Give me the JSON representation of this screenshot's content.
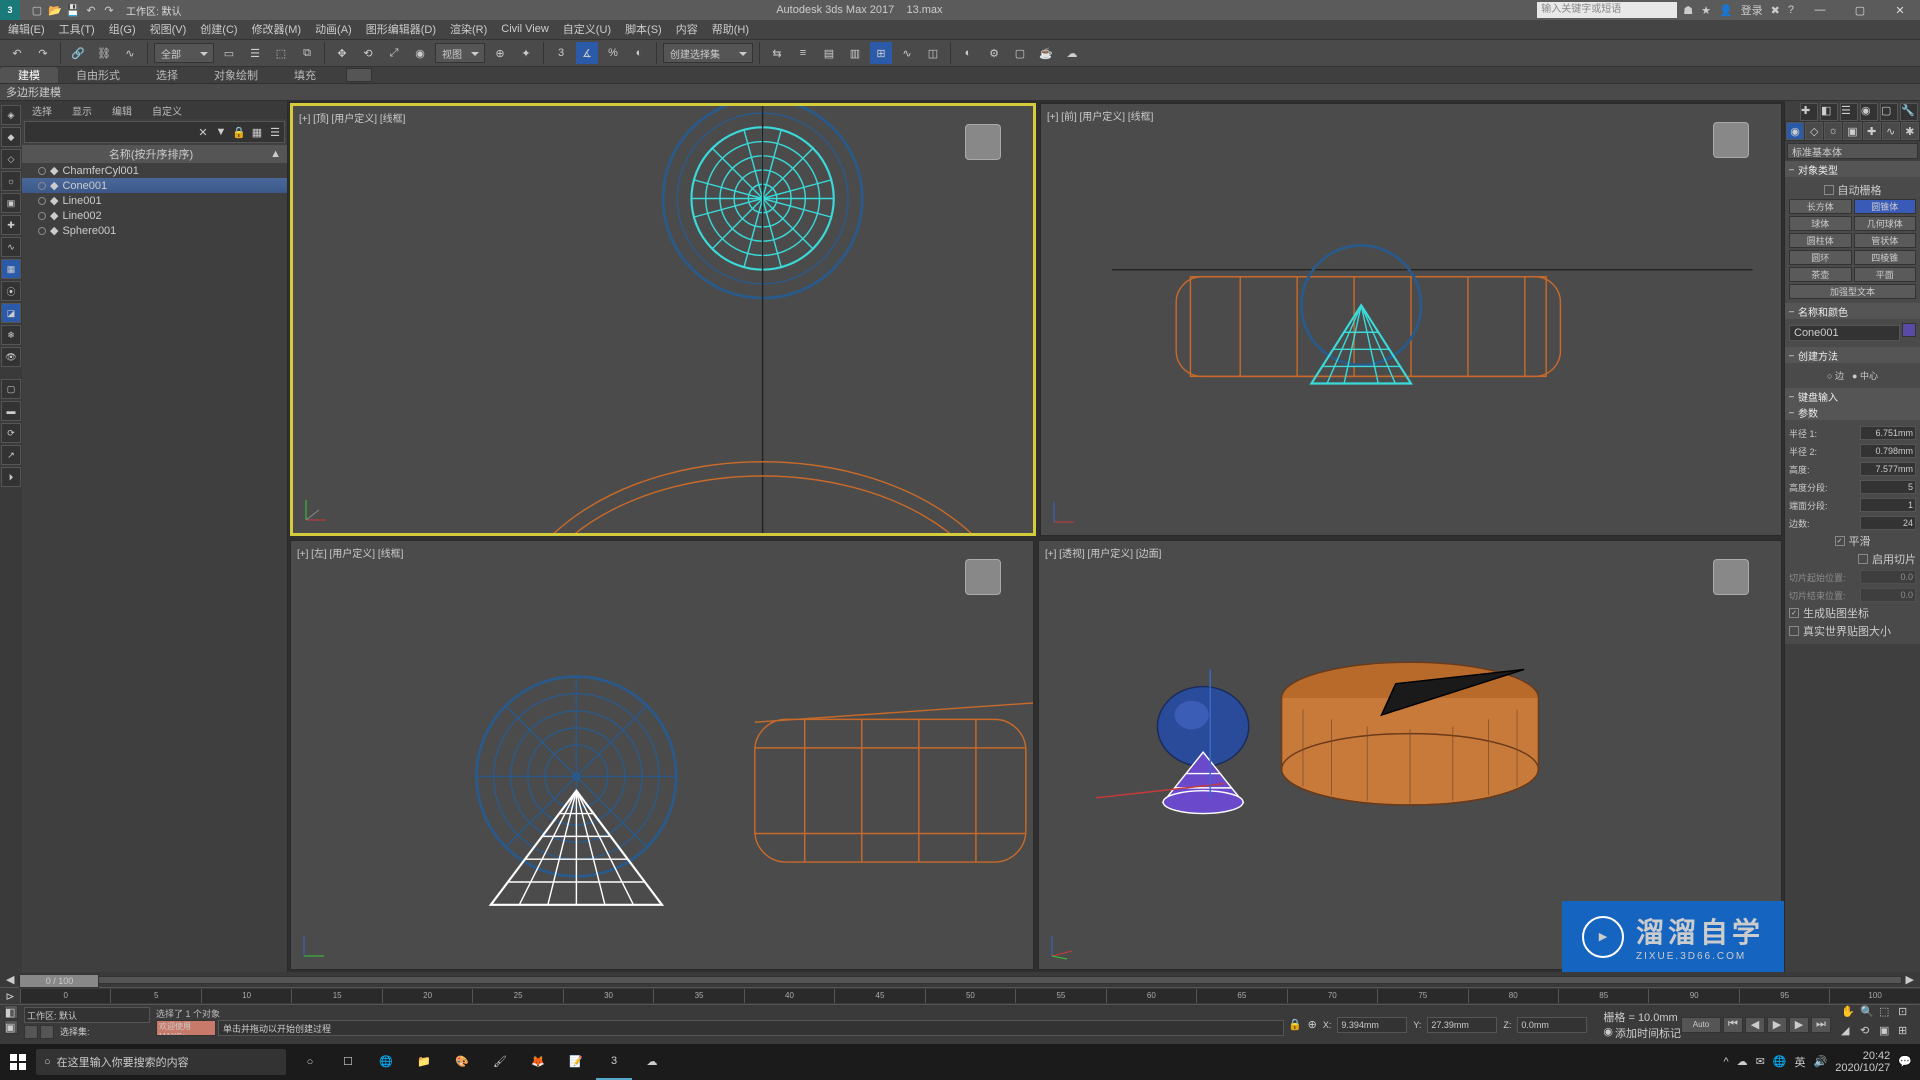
{
  "title_app": "Autodesk 3ds Max 2017",
  "title_file": "13.max",
  "workspace_label": "工作区: 默认",
  "search_placeholder": "输入关键字或短语",
  "login_label": "登录",
  "menu": [
    "编辑(E)",
    "工具(T)",
    "组(G)",
    "视图(V)",
    "创建(C)",
    "修改器(M)",
    "动画(A)",
    "图形编辑器(D)",
    "渲染(R)",
    "Civil View",
    "自定义(U)",
    "脚本(S)",
    "内容",
    "帮助(H)"
  ],
  "toolbar_dd1": "全部",
  "toolbar_dd2": "视图",
  "toolbar_dd3": "创建选择集",
  "ribbon_tabs": [
    "建模",
    "自由形式",
    "选择",
    "对象绘制",
    "填充"
  ],
  "ribbon_active": 0,
  "ribbon_sub": "多边形建模",
  "scene_tabs": [
    "选择",
    "显示",
    "编辑",
    "自定义"
  ],
  "scene_header": "名称(按升序排序)",
  "scene_items": [
    {
      "name": "ChamferCyl001"
    },
    {
      "name": "Cone001",
      "sel": true
    },
    {
      "name": "Line001"
    },
    {
      "name": "Line002"
    },
    {
      "name": "Sphere001"
    }
  ],
  "viewport_labels": {
    "top": "[+] [顶] [用户定义] [线框]",
    "front": "[+] [前] [用户定义] [线框]",
    "left": "[+] [左] [用户定义] [线框]",
    "persp": "[+] [透视] [用户定义] [边面]"
  },
  "cmd": {
    "dropdown": "标准基本体",
    "roll_object_type": "对象类型",
    "autogrid": "自动栅格",
    "primitives": {
      "box": "长方体",
      "cone": "圆锥体",
      "sphere": "球体",
      "geosphere": "几何球体",
      "cylinder": "圆柱体",
      "tube": "管状体",
      "torus": "圆环",
      "pyramid": "四棱锥",
      "teapot": "茶壶",
      "plane": "平面",
      "textplus": "加强型文本"
    },
    "primitive_selected": "cone",
    "roll_name": "名称和颜色",
    "obj_name": "Cone001",
    "roll_method": "创建方法",
    "method_opts": {
      "edge": "边",
      "center": "中心"
    },
    "method_sel": "center",
    "roll_kb": "键盘输入",
    "roll_params": "参数",
    "params": {
      "radius1_l": "半径 1:",
      "radius1_v": "6.751mm",
      "radius2_l": "半径 2:",
      "radius2_v": "0.798mm",
      "height_l": "高度:",
      "height_v": "7.577mm",
      "hseg_l": "高度分段:",
      "hseg_v": "5",
      "capseg_l": "端面分段:",
      "capseg_v": "1",
      "sides_l": "边数:",
      "sides_v": "24",
      "smooth": "平滑",
      "smooth_on": true,
      "slice": "启用切片",
      "slice_on": false,
      "slicefrom_l": "切片起始位置:",
      "slicefrom_v": "0.0",
      "sliceto_l": "切片结束位置:",
      "sliceto_v": "0.0",
      "genmap": "生成贴图坐标",
      "genmap_on": true,
      "realworld": "真实世界贴图大小",
      "realworld_on": false
    }
  },
  "timeslider": "0 / 100",
  "ticks": [
    "0",
    "5",
    "10",
    "15",
    "20",
    "25",
    "30",
    "35",
    "40",
    "45",
    "50",
    "55",
    "60",
    "65",
    "70",
    "75",
    "80",
    "85",
    "90",
    "95",
    "100"
  ],
  "status_ws": "工作区: 默认",
  "status_sel_label": "选择集:",
  "status_prompt1": "选择了 1 个对象",
  "status_prompt2": "单击并拖动以开始创建过程",
  "status_welcome": "欢迎使用 MAXSc",
  "coord": {
    "x_l": "X:",
    "x_v": "9.394mm",
    "y_l": "Y:",
    "y_v": "27.39mm",
    "z_l": "Z:",
    "z_v": "0.0mm",
    "grid_l": "栅格 =",
    "grid_v": "10.0mm",
    "addkey": "添加时间标记"
  },
  "taskbar": {
    "search": "在这里输入你要搜索的内容",
    "ime": "英",
    "time": "20:42",
    "date": "2020/10/27"
  },
  "watermark": {
    "big": "溜溜自学",
    "small": "ZIXUE.3D66.COM"
  }
}
